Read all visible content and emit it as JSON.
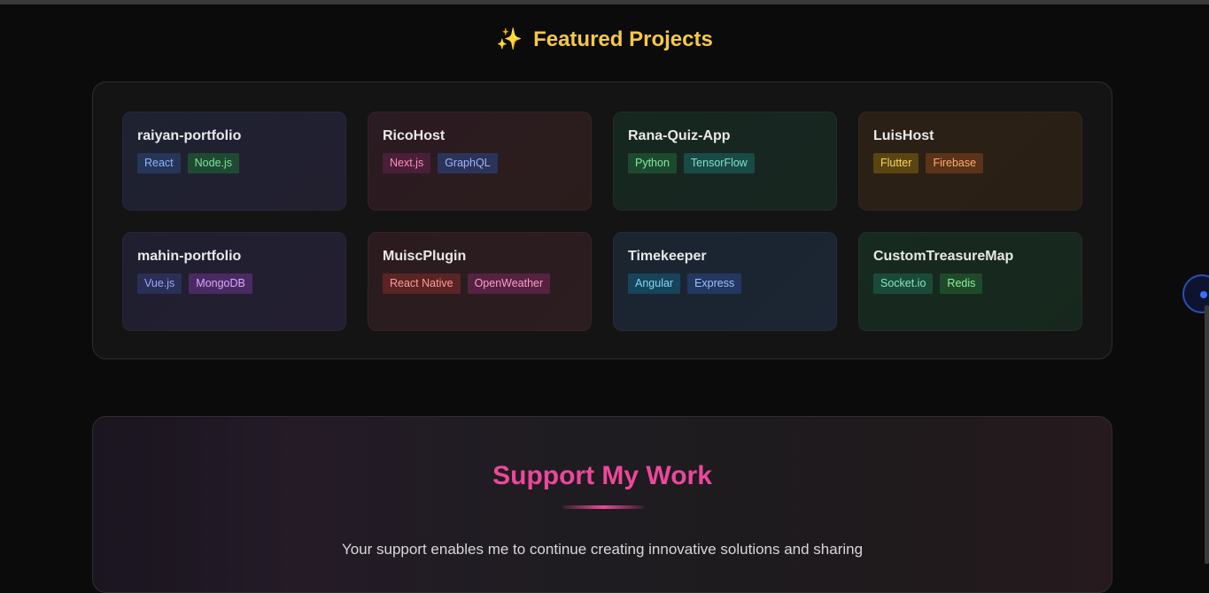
{
  "featured": {
    "sparkle": "✨",
    "title": "Featured Projects",
    "projects": [
      {
        "name": "raiyan-portfolio",
        "tags": [
          "React",
          "Node.js"
        ]
      },
      {
        "name": "RicoHost",
        "tags": [
          "Next.js",
          "GraphQL"
        ]
      },
      {
        "name": "Rana-Quiz-App",
        "tags": [
          "Python",
          "TensorFlow"
        ]
      },
      {
        "name": "LuisHost",
        "tags": [
          "Flutter",
          "Firebase"
        ]
      },
      {
        "name": "mahin-portfolio",
        "tags": [
          "Vue.js",
          "MongoDB"
        ]
      },
      {
        "name": "MuiscPlugin",
        "tags": [
          "React Native",
          "OpenWeather"
        ]
      },
      {
        "name": "Timekeeper",
        "tags": [
          "Angular",
          "Express"
        ]
      },
      {
        "name": "CustomTreasureMap",
        "tags": [
          "Socket.io",
          "Redis"
        ]
      }
    ]
  },
  "support": {
    "title": "Support My Work",
    "text": "Your support enables me to continue creating innovative solutions and sharing"
  },
  "colors": {
    "accent_title": "#f5c84a",
    "support_title": "#ec4899",
    "floating_button": "#3d6cff"
  }
}
